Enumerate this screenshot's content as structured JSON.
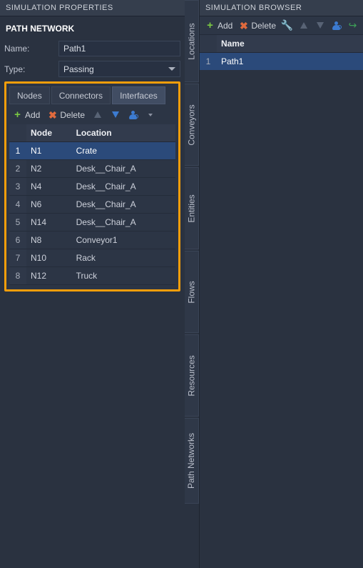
{
  "props": {
    "header": "SIMULATION PROPERTIES",
    "section": "PATH NETWORK",
    "name_label": "Name:",
    "name_value": "Path1",
    "type_label": "Type:",
    "type_value": "Passing",
    "tabs": {
      "nodes": "Nodes",
      "connectors": "Connectors",
      "interfaces": "Interfaces"
    },
    "toolbar": {
      "add": "Add",
      "delete": "Delete"
    },
    "columns": {
      "node": "Node",
      "location": "Location"
    },
    "rows": [
      {
        "idx": "1",
        "node": "N1",
        "location": "Crate",
        "selected": true
      },
      {
        "idx": "2",
        "node": "N2",
        "location": "Desk__Chair_A",
        "selected": false
      },
      {
        "idx": "3",
        "node": "N4",
        "location": "Desk__Chair_A",
        "selected": false
      },
      {
        "idx": "4",
        "node": "N6",
        "location": "Desk__Chair_A",
        "selected": false
      },
      {
        "idx": "5",
        "node": "N14",
        "location": "Desk__Chair_A",
        "selected": false
      },
      {
        "idx": "6",
        "node": "N8",
        "location": "Conveyor1",
        "selected": false
      },
      {
        "idx": "7",
        "node": "N10",
        "location": "Rack",
        "selected": false
      },
      {
        "idx": "8",
        "node": "N12",
        "location": "Truck",
        "selected": false
      }
    ]
  },
  "vtabs": {
    "locations": "Locations",
    "conveyors": "Conveyors",
    "entities": "Entities",
    "flows": "Flows",
    "resources": "Resources",
    "pathnetworks": "Path Networks"
  },
  "browser": {
    "header": "SIMULATION BROWSER",
    "toolbar": {
      "add": "Add",
      "delete": "Delete"
    },
    "columns": {
      "name": "Name"
    },
    "rows": [
      {
        "idx": "1",
        "name": "Path1",
        "selected": true
      }
    ]
  }
}
